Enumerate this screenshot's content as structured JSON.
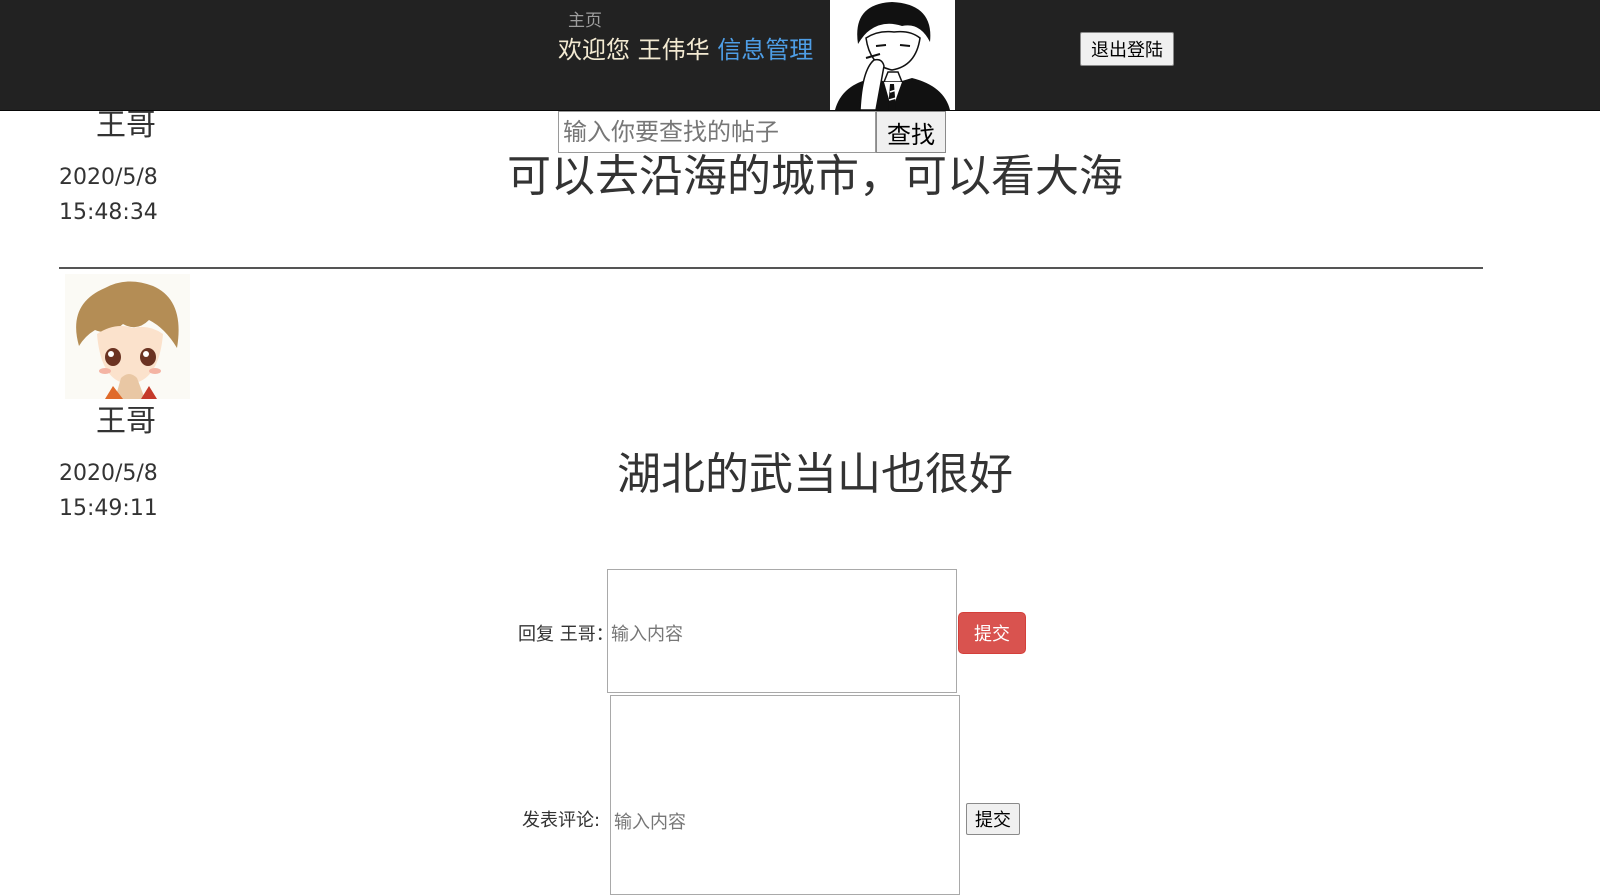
{
  "header": {
    "home_link": "主页",
    "welcome_prefix": "欢迎您 ",
    "username": "王伟华",
    "manage_link": "信息管理",
    "logout_button": "退出登陆"
  },
  "search": {
    "placeholder": "输入你要查找的帖子",
    "button": "查找"
  },
  "posts": [
    {
      "author": "王哥",
      "date": "2020/5/8",
      "time": "15:48:34",
      "content": "可以去沿海的城市，可以看大海"
    },
    {
      "author": "王哥",
      "date": "2020/5/8",
      "time": "15:49:11",
      "content": "湖北的武当山也很好"
    }
  ],
  "reply": {
    "label": "回复 王哥：",
    "placeholder": "输入内容",
    "submit": "提交"
  },
  "comment": {
    "label": "发表评论:",
    "placeholder": "输入内容",
    "submit": "提交"
  }
}
